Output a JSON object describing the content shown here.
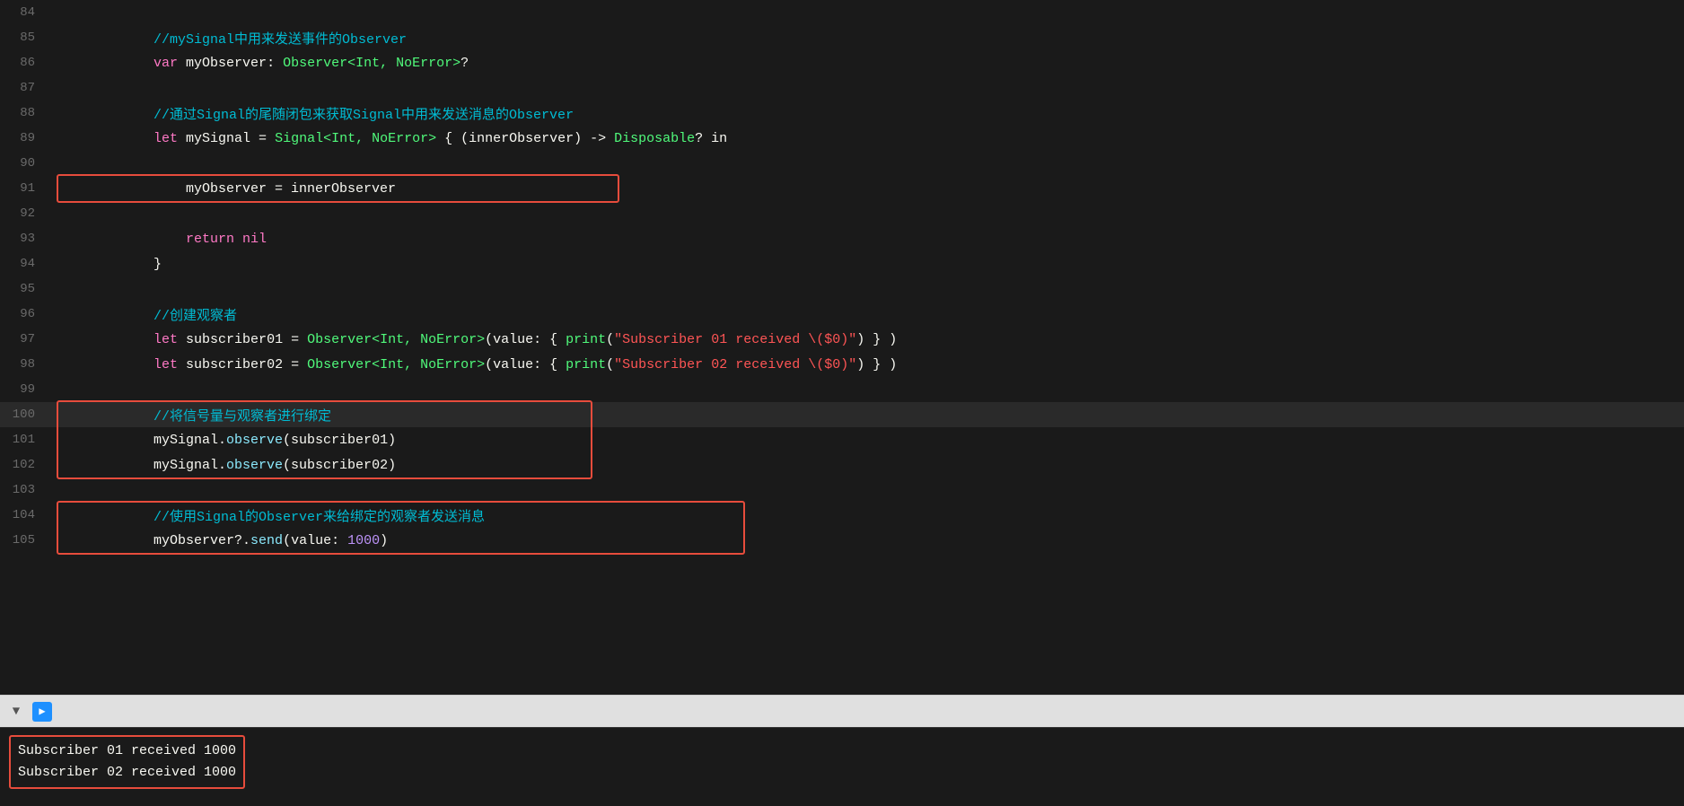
{
  "lines": [
    {
      "number": "84",
      "content": "",
      "tokens": []
    },
    {
      "number": "85",
      "content": "            //mySignal中用来发送事件的Observer",
      "tokens": [
        {
          "text": "            ",
          "class": "plain"
        },
        {
          "text": "//mySignal中用来发送事件的Observer",
          "class": "comment"
        }
      ]
    },
    {
      "number": "86",
      "content": "            var myObserver: Observer<Int, NoError>?",
      "tokens": [
        {
          "text": "            ",
          "class": "plain"
        },
        {
          "text": "var",
          "class": "kw-var"
        },
        {
          "text": " myObserver: ",
          "class": "plain"
        },
        {
          "text": "Observer<Int, NoError>",
          "class": "type-name"
        },
        {
          "text": "?",
          "class": "plain"
        }
      ]
    },
    {
      "number": "87",
      "content": "",
      "tokens": []
    },
    {
      "number": "88",
      "content": "            //通过Signal的尾随闭包来获取Signal中用来发送消息的Observer",
      "tokens": [
        {
          "text": "            ",
          "class": "plain"
        },
        {
          "text": "//通过Signal的尾随闭包来获取Signal中用来发送消息的Observer",
          "class": "comment"
        }
      ]
    },
    {
      "number": "89",
      "content": "            let mySignal = Signal<Int, NoError> { (innerObserver) -> Disposable? in",
      "tokens": [
        {
          "text": "            ",
          "class": "plain"
        },
        {
          "text": "let",
          "class": "kw-let"
        },
        {
          "text": " mySignal = ",
          "class": "plain"
        },
        {
          "text": "Signal<Int, NoError>",
          "class": "type-name"
        },
        {
          "text": " { (innerObserver) -> ",
          "class": "plain"
        },
        {
          "text": "Disposable",
          "class": "type-name"
        },
        {
          "text": "? in",
          "class": "plain"
        }
      ]
    },
    {
      "number": "90",
      "content": "",
      "tokens": []
    },
    {
      "number": "91",
      "content": "                myObserver = innerObserver",
      "boxed": true,
      "tokens": [
        {
          "text": "                myObserver = innerObserver",
          "class": "plain"
        }
      ]
    },
    {
      "number": "92",
      "content": "",
      "tokens": []
    },
    {
      "number": "93",
      "content": "                return nil",
      "tokens": [
        {
          "text": "                ",
          "class": "plain"
        },
        {
          "text": "return",
          "class": "return-kw"
        },
        {
          "text": " nil",
          "class": "nil-kw"
        }
      ]
    },
    {
      "number": "94",
      "content": "            }",
      "tokens": [
        {
          "text": "            }",
          "class": "plain"
        }
      ]
    },
    {
      "number": "95",
      "content": "",
      "tokens": []
    },
    {
      "number": "96",
      "content": "            //创建观察者",
      "tokens": [
        {
          "text": "            ",
          "class": "plain"
        },
        {
          "text": "//创建观察者",
          "class": "comment"
        }
      ]
    },
    {
      "number": "97",
      "content": "            let subscriber01 = Observer<Int, NoError>(value: { print(\"Subscriber 01 received \\($0)\") } )",
      "tokens": [
        {
          "text": "            ",
          "class": "plain"
        },
        {
          "text": "let",
          "class": "kw-let"
        },
        {
          "text": " subscriber01 = ",
          "class": "plain"
        },
        {
          "text": "Observer<Int, NoError>",
          "class": "type-name"
        },
        {
          "text": "(value: { ",
          "class": "plain"
        },
        {
          "text": "print",
          "class": "print-kw"
        },
        {
          "text": "(",
          "class": "plain"
        },
        {
          "text": "\"Subscriber 01 received \\($0)\"",
          "class": "string"
        },
        {
          "text": ") } )",
          "class": "plain"
        }
      ]
    },
    {
      "number": "98",
      "content": "            let subscriber02 = Observer<Int, NoError>(value: { print(\"Subscriber 02 received \\($0)\") } )",
      "tokens": [
        {
          "text": "            ",
          "class": "plain"
        },
        {
          "text": "let",
          "class": "kw-let"
        },
        {
          "text": " subscriber02 = ",
          "class": "plain"
        },
        {
          "text": "Observer<Int, NoError>",
          "class": "type-name"
        },
        {
          "text": "(value: { ",
          "class": "plain"
        },
        {
          "text": "print",
          "class": "print-kw"
        },
        {
          "text": "(",
          "class": "plain"
        },
        {
          "text": "\"Subscriber 02 received \\($0)\"",
          "class": "string"
        },
        {
          "text": ") } )",
          "class": "plain"
        }
      ]
    },
    {
      "number": "99",
      "content": "",
      "tokens": []
    },
    {
      "number": "100",
      "content": "            //将信号量与观察者进行绑定",
      "current": true,
      "boxedGroup": "bind",
      "tokens": [
        {
          "text": "            ",
          "class": "plain"
        },
        {
          "text": "//将信号量与观察者进行绑定",
          "class": "comment"
        }
      ]
    },
    {
      "number": "101",
      "content": "            mySignal.observe(subscriber01)",
      "boxedGroup": "bind",
      "tokens": [
        {
          "text": "            mySignal.",
          "class": "plain"
        },
        {
          "text": "observe",
          "class": "method"
        },
        {
          "text": "(subscriber01)",
          "class": "plain"
        }
      ]
    },
    {
      "number": "102",
      "content": "            mySignal.observe(subscriber02)",
      "boxedGroup": "bind",
      "tokens": [
        {
          "text": "            mySignal.",
          "class": "plain"
        },
        {
          "text": "observe",
          "class": "method"
        },
        {
          "text": "(subscriber02)",
          "class": "plain"
        }
      ]
    },
    {
      "number": "103",
      "content": "",
      "tokens": []
    },
    {
      "number": "104",
      "content": "            //使用Signal的Observer来给绑定的观察者发送消息",
      "boxedGroup": "send",
      "tokens": [
        {
          "text": "            ",
          "class": "plain"
        },
        {
          "text": "//使用Signal的Observer来给绑定的观察者发送消息",
          "class": "comment"
        }
      ]
    },
    {
      "number": "105",
      "content": "            myObserver?.send(value: 1000)",
      "boxedGroup": "send",
      "tokens": [
        {
          "text": "            myObserver?.",
          "class": "plain"
        },
        {
          "text": "send",
          "class": "method"
        },
        {
          "text": "(value: ",
          "class": "plain"
        },
        {
          "text": "1000",
          "class": "number-lit"
        },
        {
          "text": ")",
          "class": "plain"
        }
      ]
    }
  ],
  "toolbar": {
    "filter_icon": "▼",
    "run_icon": "▶"
  },
  "console": {
    "line1": "Subscriber 01 received 1000",
    "line2": "Subscriber 02 received 1000"
  }
}
